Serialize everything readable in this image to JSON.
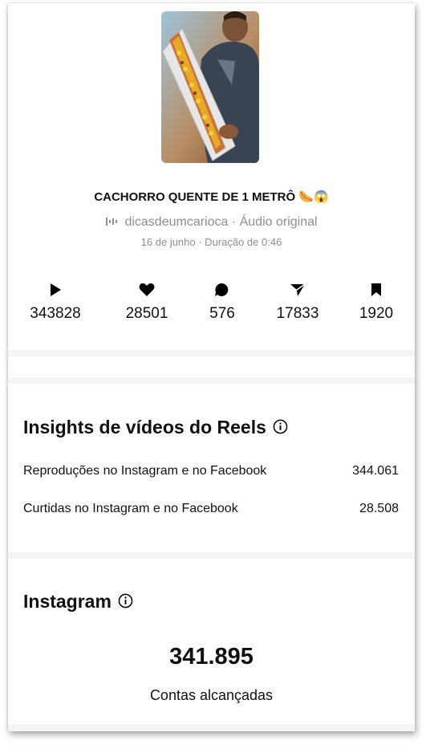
{
  "reel": {
    "title": "CACHORRO QUENTE DE 1 METRÔ 🌭😱",
    "audio": "dicasdeumcarioca · Áudio original",
    "meta": "16 de junho · Duração de 0:46"
  },
  "stats": [
    {
      "icon": "play-icon",
      "value": "343828"
    },
    {
      "icon": "heart-icon",
      "value": "28501"
    },
    {
      "icon": "comment-icon",
      "value": "576"
    },
    {
      "icon": "share-icon",
      "value": "17833"
    },
    {
      "icon": "bookmark-icon",
      "value": "1920"
    }
  ],
  "insights": {
    "title": "Insights de vídeos do Reels",
    "rows": [
      {
        "label": "Reproduções no Instagram e no Facebook",
        "value": "344.061"
      },
      {
        "label": "Curtidas no Instagram e no Facebook",
        "value": "28.508"
      }
    ]
  },
  "instagram": {
    "title": "Instagram",
    "reach_value": "341.895",
    "reach_label": "Contas alcançadas"
  }
}
